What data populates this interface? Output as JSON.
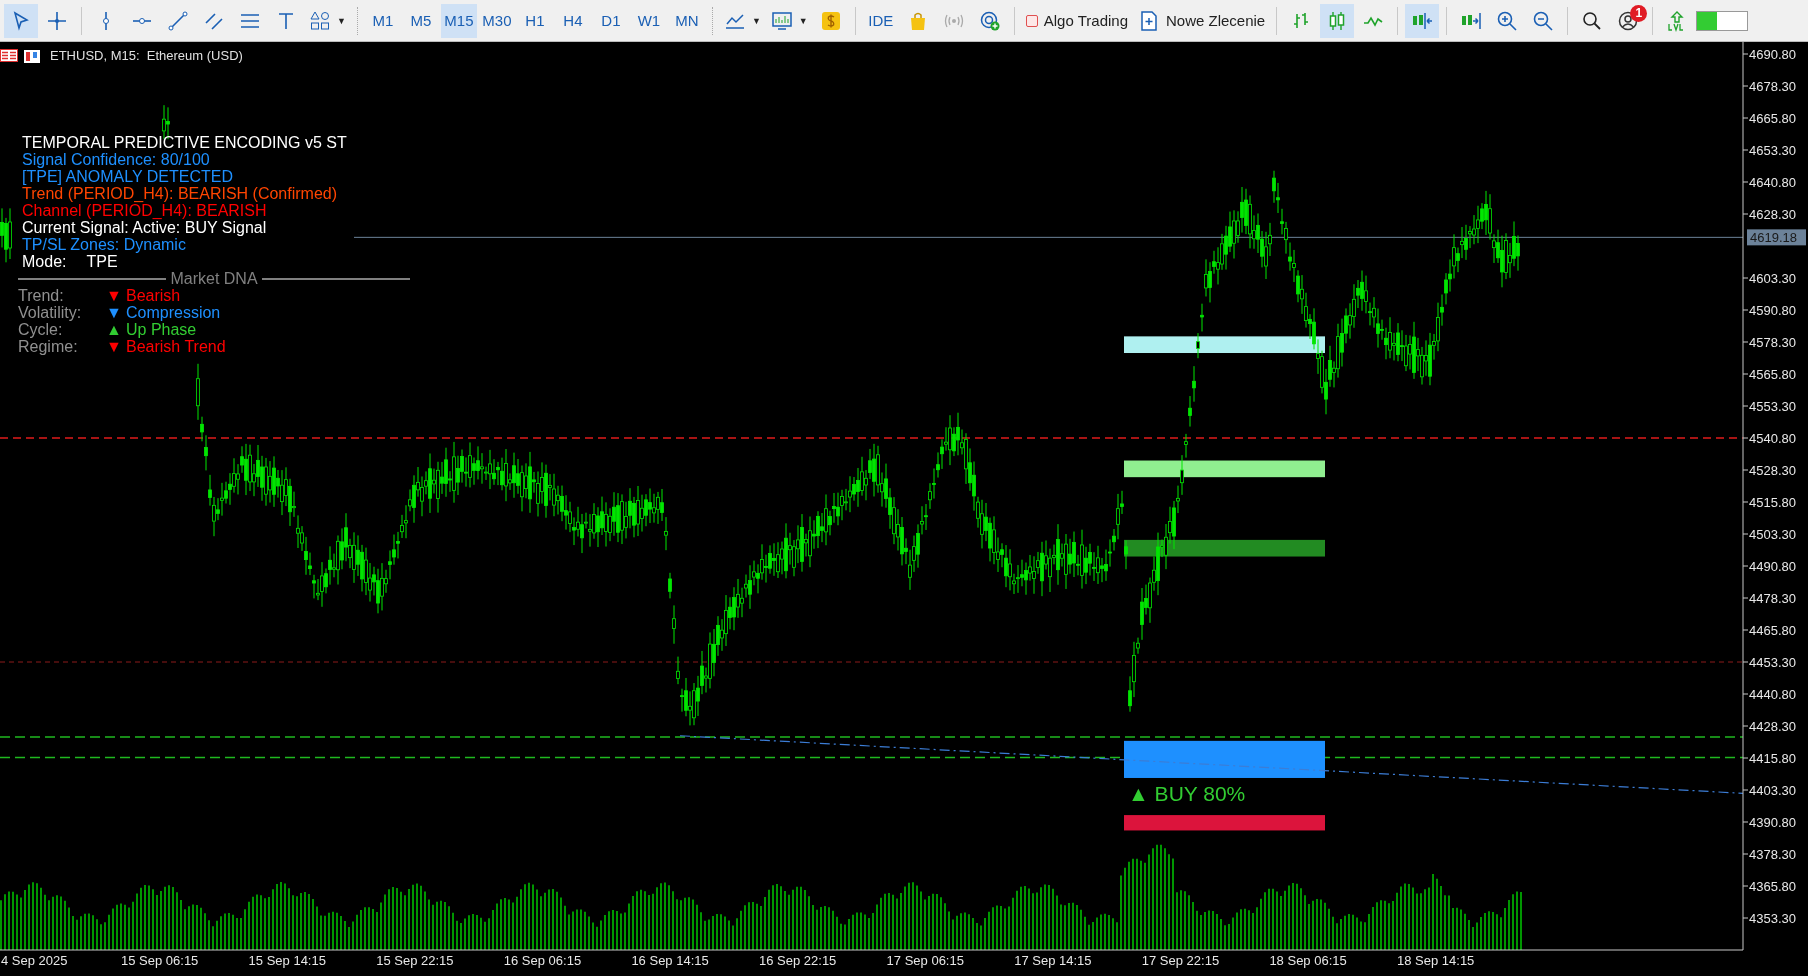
{
  "toolbar": {
    "cursor_tool": {
      "selected": true
    },
    "timeframes": [
      {
        "label": "M1",
        "selected": false
      },
      {
        "label": "M5",
        "selected": false
      },
      {
        "label": "M15",
        "selected": true
      },
      {
        "label": "M30",
        "selected": false
      },
      {
        "label": "H1",
        "selected": false
      },
      {
        "label": "H4",
        "selected": false
      },
      {
        "label": "D1",
        "selected": false
      },
      {
        "label": "W1",
        "selected": false
      },
      {
        "label": "MN",
        "selected": false
      }
    ],
    "ide_label": "IDE",
    "algo_trading": {
      "label": "Algo Trading",
      "on": false
    },
    "new_order": "Nowe Zlecenie",
    "chart_types": [
      {
        "kind": "bars",
        "selected": false
      },
      {
        "kind": "candles",
        "selected": true
      },
      {
        "kind": "line",
        "selected": false
      }
    ],
    "auto_scroll": {
      "selected": true
    },
    "chart_shift": {
      "selected": false
    },
    "notifications": "1"
  },
  "chart": {
    "header": "ETHUSD, M15:  Ethereum (USD)",
    "info_panel": {
      "title": "TEMPORAL PREDICTIVE ENCODING v5 ST",
      "lines": [
        {
          "text": "Signal Confidence: 80/100",
          "color": "#1e90ff"
        },
        {
          "text": "[TPE] ANOMALY DETECTED",
          "color": "#1e90ff"
        },
        {
          "text": "Trend (PERIOD_H4): BEARISH (Confirmed)",
          "color": "#ff4500"
        },
        {
          "text": "Channel (PERIOD_H4): BEARISH",
          "color": "#ff0000"
        },
        {
          "text": "Current Signal: Active: BUY Signal",
          "color": "#ffffff"
        },
        {
          "text": "TP/SL Zones: Dynamic",
          "color": "#1e90ff"
        }
      ],
      "mode_label": "Mode:",
      "mode_value": "TPE",
      "dna_title": "Market DNA",
      "dna_rows": [
        {
          "label": "Trend:",
          "arrow": "▼",
          "value": "Bearish",
          "color": "#ff0000"
        },
        {
          "label": "Volatility:",
          "arrow": "▼",
          "value": "Compression",
          "color": "#1e90ff"
        },
        {
          "label": "Cycle:",
          "arrow": "▲",
          "value": "Up Phase",
          "color": "#32cd32"
        },
        {
          "label": "Regime:",
          "arrow": "▼",
          "value": "Bearish Trend",
          "color": "#ff0000"
        }
      ]
    },
    "signal_label": "▲ BUY 80%",
    "price_labels": [
      "4690.80",
      "4678.30",
      "4665.80",
      "4653.30",
      "4640.80",
      "4628.30",
      "4603.30",
      "4590.80",
      "4578.30",
      "4565.80",
      "4553.30",
      "4540.80",
      "4528.30",
      "4515.80",
      "4503.30",
      "4490.80",
      "4478.30",
      "4465.80",
      "4453.30",
      "4440.80",
      "4428.30",
      "4415.80",
      "4403.30",
      "4390.80",
      "4378.30",
      "4365.80",
      "4353.30"
    ],
    "current_price": "4619.18",
    "time_labels": [
      "4 Sep 2025",
      "15 Sep 06:15",
      "15 Sep 14:15",
      "15 Sep 22:15",
      "16 Sep 06:15",
      "16 Sep 14:15",
      "16 Sep 22:15",
      "17 Sep 06:15",
      "17 Sep 14:15",
      "17 Sep 22:15",
      "18 Sep 06:15",
      "18 Sep 14:15"
    ]
  }
}
